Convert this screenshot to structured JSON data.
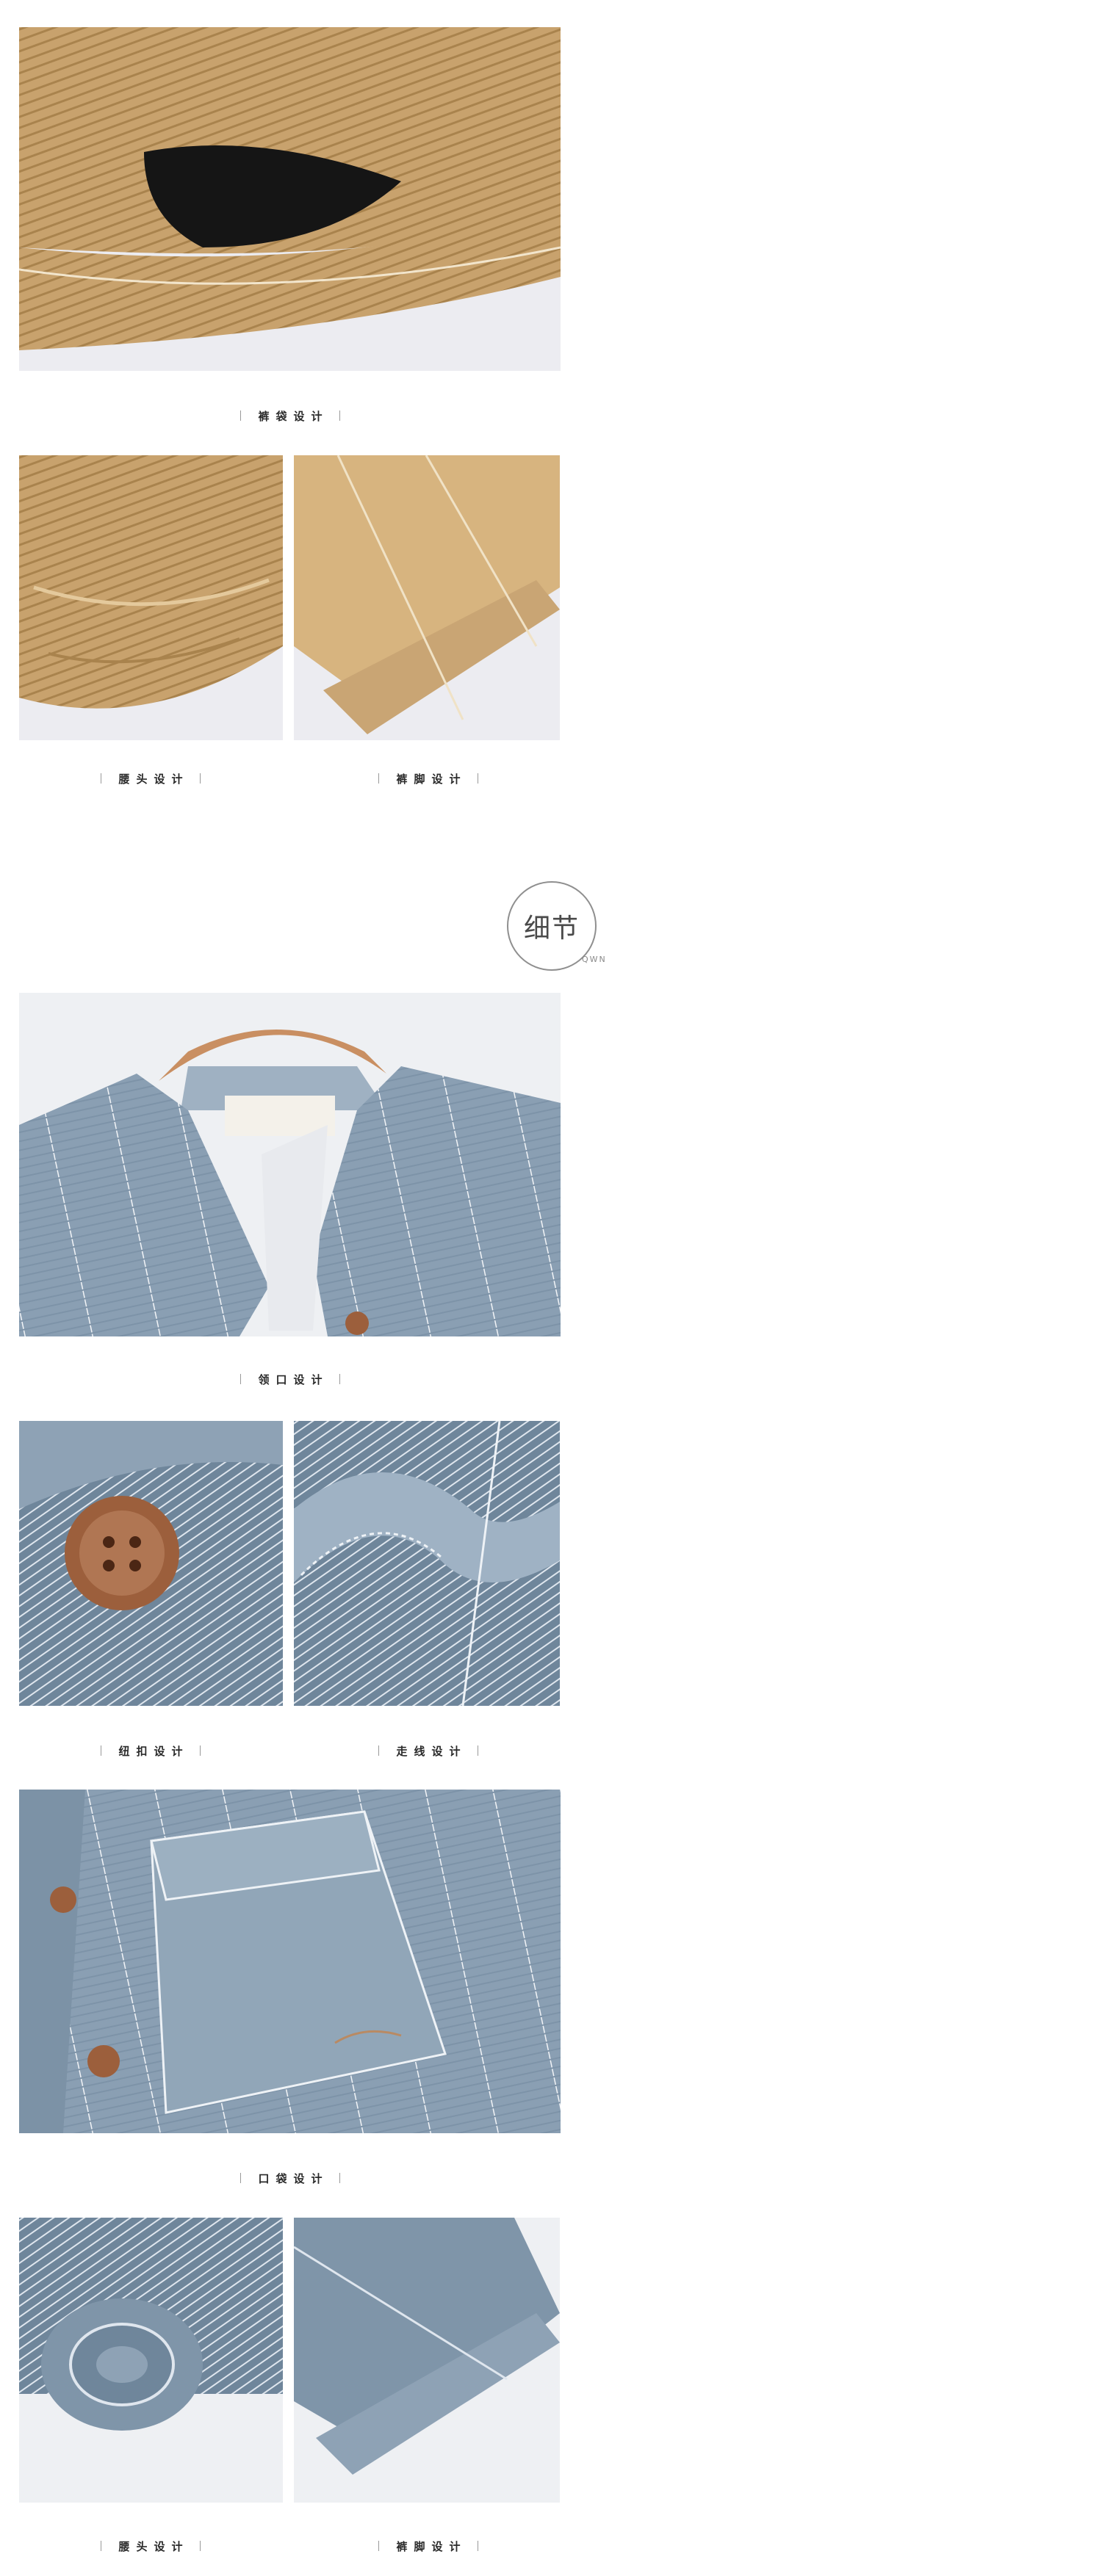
{
  "captions": {
    "pocket_khaki": "裤袋设计",
    "waist_khaki": "腰头设计",
    "hem_khaki": "裤脚设计",
    "collar": "领口设计",
    "button": "纽扣设计",
    "stitch": "走线设计",
    "pocket_blue": "口袋设计",
    "waist_blue": "腰头设计",
    "hem_blue": "裤脚设计"
  },
  "badge": {
    "title": "细节",
    "subtitle": "QWN"
  },
  "colors": {
    "khaki": "#c9a574",
    "khaki_dark": "#a9854f",
    "blue": "#8a9fb3",
    "blue_dark": "#5f7486",
    "wood": "#9c5f3c"
  }
}
